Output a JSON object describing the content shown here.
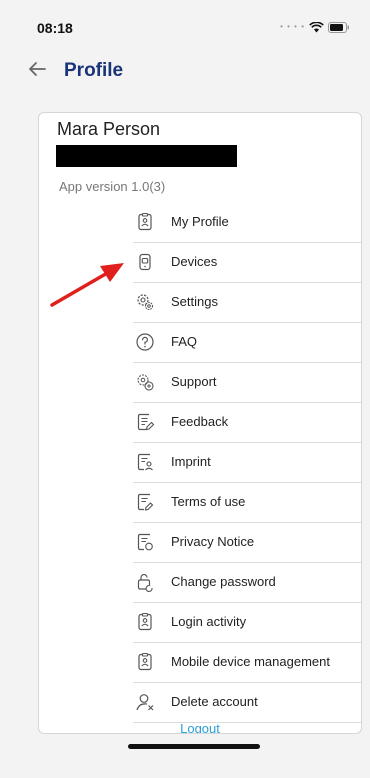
{
  "status_bar": {
    "time": "08:18"
  },
  "header": {
    "title": "Profile"
  },
  "profile": {
    "name": "Mara Person",
    "app_version": "App version 1.0(3)"
  },
  "menu": [
    {
      "label": "My Profile",
      "icon": "id-badge-icon"
    },
    {
      "label": "Devices",
      "icon": "device-icon"
    },
    {
      "label": "Settings",
      "icon": "settings-icon"
    },
    {
      "label": "FAQ",
      "icon": "question-icon"
    },
    {
      "label": "Support",
      "icon": "support-icon"
    },
    {
      "label": "Feedback",
      "icon": "feedback-icon"
    },
    {
      "label": "Imprint",
      "icon": "imprint-icon"
    },
    {
      "label": "Terms of use",
      "icon": "terms-icon"
    },
    {
      "label": "Privacy Notice",
      "icon": "privacy-icon"
    },
    {
      "label": "Change password",
      "icon": "password-icon"
    },
    {
      "label": "Login activity",
      "icon": "id-badge-icon"
    },
    {
      "label": "Mobile device management",
      "icon": "id-badge-icon"
    },
    {
      "label": "Delete account",
      "icon": "delete-user-icon"
    }
  ],
  "logout_label": "Logout",
  "colors": {
    "title": "#1a3478",
    "logout": "#2aa0d8",
    "annotation_arrow": "#e0201c"
  }
}
